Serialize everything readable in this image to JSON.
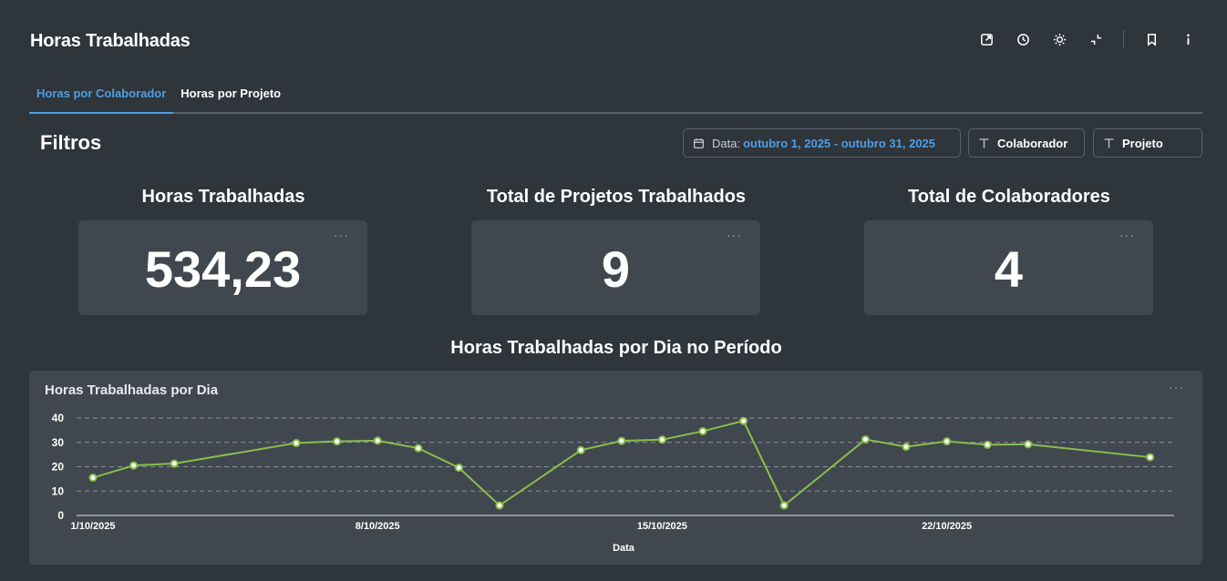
{
  "header": {
    "title": "Horas Trabalhadas"
  },
  "tabs": [
    {
      "label": "Horas por Colaborador",
      "active": true
    },
    {
      "label": "Horas por Projeto",
      "active": false
    }
  ],
  "filters": {
    "title": "Filtros",
    "date_label": "Data:",
    "date_value": "outubro 1, 2025 - outubro 31, 2025",
    "colaborador_label": "Colaborador",
    "projeto_label": "Projeto"
  },
  "kpis": [
    {
      "title": "Horas Trabalhadas",
      "value": "534,23",
      "menu": "···"
    },
    {
      "title": "Total de Projetos Trabalhados",
      "value": "9",
      "menu": "···"
    },
    {
      "title": "Total de Colaboradores",
      "value": "4",
      "menu": "···"
    }
  ],
  "chart_section": {
    "heading": "Horas Trabalhadas por Dia no Período"
  },
  "chart_card": {
    "title": "Horas Trabalhadas por Dia",
    "menu": "···"
  },
  "colors": {
    "accent": "#509ee3",
    "line": "#88bf4d",
    "background": "#2e353b",
    "card": "#41474e"
  },
  "chart_data": {
    "type": "line",
    "title": "Horas Trabalhadas por Dia",
    "xlabel": "Data",
    "ylabel": "",
    "ylim": [
      0,
      40
    ],
    "yticks": [
      0,
      10,
      20,
      30,
      40
    ],
    "xticks": [
      "1/10/2025",
      "8/10/2025",
      "15/10/2025",
      "22/10/2025"
    ],
    "grid": true,
    "x": [
      "1/10/2025",
      "2/10/2025",
      "3/10/2025",
      "6/10/2025",
      "7/10/2025",
      "8/10/2025",
      "9/10/2025",
      "10/10/2025",
      "11/10/2025",
      "13/10/2025",
      "14/10/2025",
      "15/10/2025",
      "16/10/2025",
      "17/10/2025",
      "18/10/2025",
      "20/10/2025",
      "21/10/2025",
      "22/10/2025",
      "23/10/2025",
      "24/10/2025",
      "27/10/2025"
    ],
    "series": [
      {
        "values": [
          15.5,
          20.5,
          21.3,
          29.7,
          30.4,
          30.7,
          27.6,
          19.6,
          4.1,
          26.8,
          30.6,
          31.1,
          34.6,
          38.8,
          4.1,
          31.2,
          28.2,
          30.4,
          29.0,
          29.2,
          23.9
        ]
      }
    ]
  }
}
